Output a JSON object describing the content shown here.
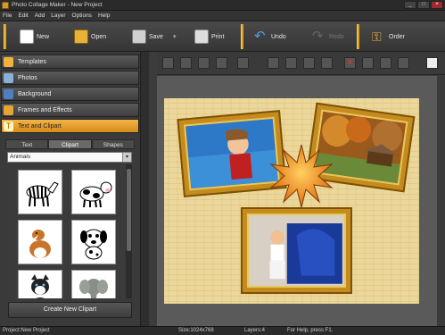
{
  "window": {
    "title": "Photo Collage Maker - New Project"
  },
  "menu": [
    "File",
    "Edit",
    "Add",
    "Layer",
    "Options",
    "Help"
  ],
  "toolbar": {
    "new": "New",
    "open": "Open",
    "save": "Save",
    "print": "Print",
    "undo": "Undo",
    "redo": "Redo",
    "order": "Order"
  },
  "accordion": [
    "Templates",
    "Photos",
    "Background",
    "Frames and Effects",
    "Text and Clipart"
  ],
  "tabs": [
    "Text",
    "Clipart",
    "Shapes"
  ],
  "clipart_category": "Animals",
  "create_clipart": "Create New Clipart",
  "status": {
    "project": "Project:New Project",
    "size": "Size:1024x768",
    "layers": "Layers:4",
    "help": "For Help, press F1."
  },
  "colors": {
    "accent": "#e0a020",
    "active_tab": "#f2b23f"
  }
}
